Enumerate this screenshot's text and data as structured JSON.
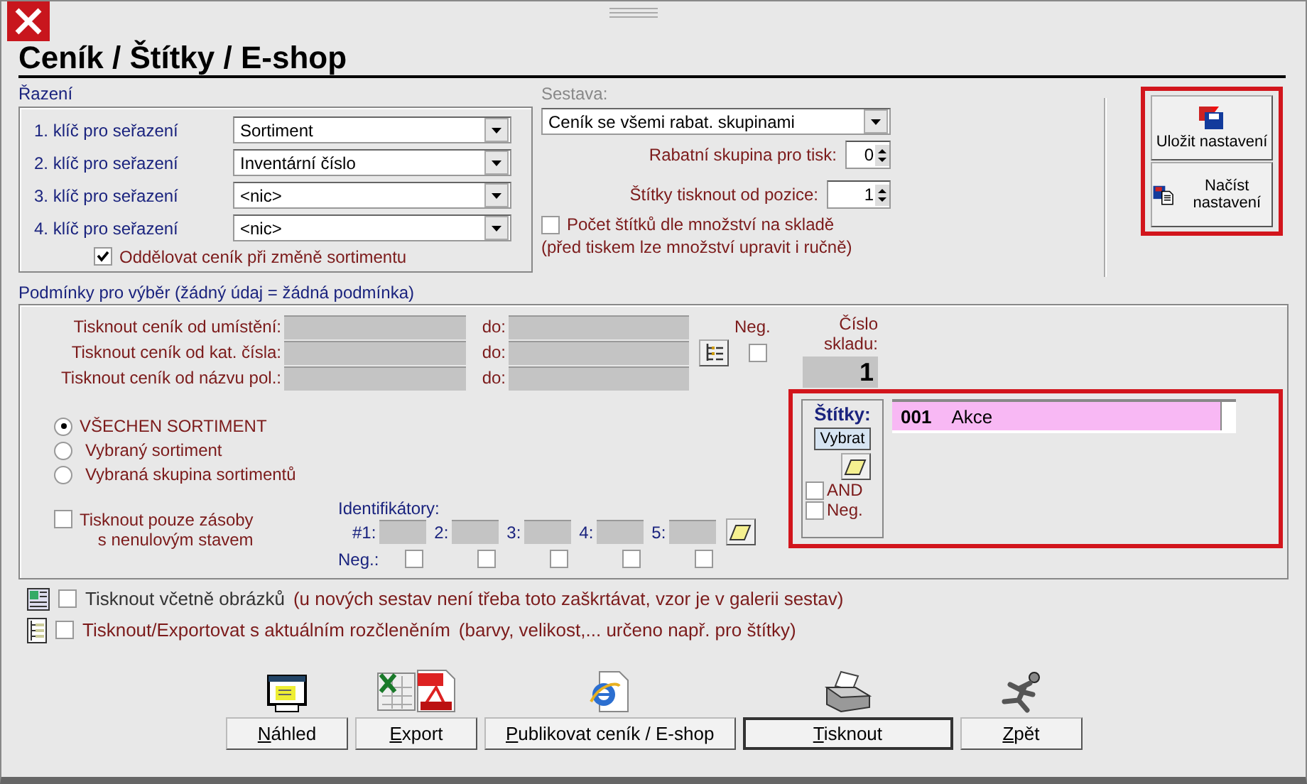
{
  "window": {
    "title": "Ceník / Štítky / E-shop"
  },
  "sorting": {
    "title": "Řazení",
    "keys": [
      {
        "label": "1. klíč pro seřazení",
        "value": "Sortiment"
      },
      {
        "label": "2. klíč pro seřazení",
        "value": "Inventární číslo"
      },
      {
        "label": "3. klíč pro seřazení",
        "value": "<nic>"
      },
      {
        "label": "4. klíč pro seřazení",
        "value": "<nic>"
      }
    ],
    "separate": {
      "label": "Oddělovat ceník při změně sortimentu",
      "checked": true
    }
  },
  "report": {
    "title": "Sestava:",
    "value": "Ceník se všemi rabat. skupinami",
    "discount_group": {
      "label": "Rabatní skupina pro tisk:",
      "value": "0"
    },
    "label_start": {
      "label": "Štítky tisknout od pozice:",
      "value": "1"
    },
    "count_by_stock": {
      "label": "Počet štítků dle množství na skladě",
      "checked": false
    },
    "note": "(před tiskem lze množství upravit i ručně)"
  },
  "settings": {
    "highlighted": true,
    "buttons": [
      {
        "label": "Uložit nastavení"
      },
      {
        "label": "Načíst nastavení"
      }
    ]
  },
  "conditions": {
    "title": "Podmínky pro výběr (žádný údaj = žádná podmínka)",
    "ranges": [
      {
        "label": "Tisknout ceník od umístění:",
        "to_label": "do:"
      },
      {
        "label": "Tisknout ceník od kat. čísla:",
        "to_label": "do:"
      },
      {
        "label": "Tisknout ceník od názvu pol.:",
        "to_label": "do:"
      }
    ],
    "neg": {
      "label": "Neg.",
      "checked": false
    },
    "warehouse": {
      "label": "Číslo skladu:",
      "value": "1"
    },
    "scope": [
      {
        "label": "VŠECHEN SORTIMENT",
        "selected": true
      },
      {
        "label": "Vybraný sortiment",
        "selected": false
      },
      {
        "label": "Vybraná skupina sortimentů",
        "selected": false
      }
    ],
    "stock_only": {
      "lines": [
        "Tisknout pouze zásoby",
        "s nenulovým stavem"
      ],
      "checked": false
    },
    "identifiers": {
      "title": "Identifikátory:",
      "neg_label": "Neg.:",
      "items": [
        {
          "label": "#1:",
          "neg": false
        },
        {
          "label": "2:",
          "neg": false
        },
        {
          "label": "3:",
          "neg": false
        },
        {
          "label": "4:",
          "neg": false
        },
        {
          "label": "5:",
          "neg": false
        }
      ]
    },
    "tags": {
      "highlighted": true,
      "title": "Štítky:",
      "select_button": "Vybrat",
      "and": {
        "label": "AND",
        "checked": false
      },
      "neg": {
        "label": "Neg.",
        "checked": false
      },
      "items": [
        {
          "code": "001",
          "name": "Akce"
        }
      ]
    }
  },
  "options": [
    {
      "label": "Tisknout včetně obrázků",
      "note": "(u nových sestav není třeba toto zaškrtávat, vzor je v galerii sestav)",
      "checked": false
    },
    {
      "label": "Tisknout/Exportovat s aktuálním rozčleněním",
      "note": "(barvy, velikost,... určeno např. pro štítky)",
      "checked": false
    }
  ],
  "actions": [
    {
      "label": "Náhled",
      "default": false
    },
    {
      "label": "Export",
      "default": false
    },
    {
      "label": "Publikovat ceník / E-shop",
      "default": false
    },
    {
      "label": "Tisknout",
      "default": true
    },
    {
      "label": "Zpět",
      "default": false
    }
  ]
}
